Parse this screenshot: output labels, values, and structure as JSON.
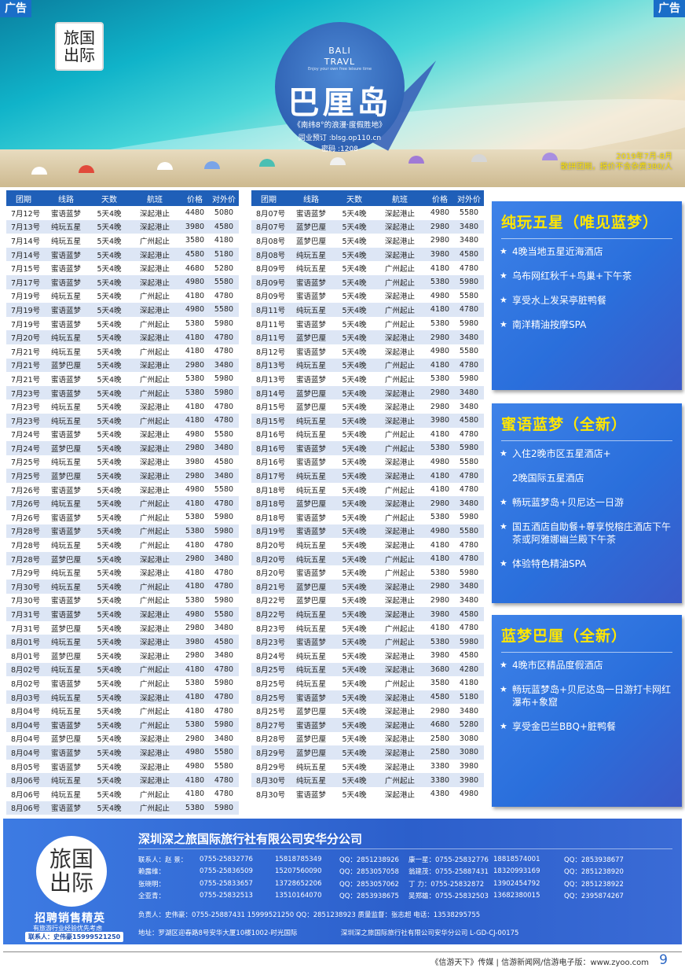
{
  "ads": {
    "left": "广告",
    "right": "广告"
  },
  "banner": {
    "logo_top": "旅国",
    "logo_bottom": "出际",
    "circle_line1": "BALI",
    "circle_line2": "TRAVL",
    "circle_small": "Enjoy your own free leisure time",
    "title": "巴厘岛",
    "subtitle": "《南纬8°的浪漫·度假胜地》",
    "peer_booking": "同业预订 :blsg.op110.cn",
    "password": "密码 :1208",
    "date_info": "2019年7月-8月",
    "note": "散拼团期，报价不含杂费380/人"
  },
  "table_headers": [
    "团期",
    "线路",
    "天数",
    "航班",
    "价格",
    "对外价"
  ],
  "table_left": [
    [
      "7月12号",
      "蜜语蓝梦",
      "5天4晚",
      "深起港止",
      "4480",
      "5080"
    ],
    [
      "7月13号",
      "纯玩五星",
      "5天4晚",
      "深起港止",
      "3980",
      "4580"
    ],
    [
      "7月14号",
      "纯玩五星",
      "5天4晚",
      "广州起止",
      "3580",
      "4180"
    ],
    [
      "7月14号",
      "蜜语蓝梦",
      "5天4晚",
      "深起港止",
      "4580",
      "5180"
    ],
    [
      "7月15号",
      "蜜语蓝梦",
      "5天4晚",
      "深起港止",
      "4680",
      "5280"
    ],
    [
      "7月17号",
      "蜜语蓝梦",
      "5天4晚",
      "深起港止",
      "4980",
      "5580"
    ],
    [
      "7月19号",
      "纯玩五星",
      "5天4晚",
      "广州起止",
      "4180",
      "4780"
    ],
    [
      "7月19号",
      "蜜语蓝梦",
      "5天4晚",
      "深起港止",
      "4980",
      "5580"
    ],
    [
      "7月19号",
      "蜜语蓝梦",
      "5天4晚",
      "广州起止",
      "5380",
      "5980"
    ],
    [
      "7月20号",
      "纯玩五星",
      "5天4晚",
      "深起港止",
      "4180",
      "4780"
    ],
    [
      "7月21号",
      "纯玩五星",
      "5天4晚",
      "广州起止",
      "4180",
      "4780"
    ],
    [
      "7月21号",
      "蓝梦巴厘",
      "5天4晚",
      "深起港止",
      "2980",
      "3480"
    ],
    [
      "7月21号",
      "蜜语蓝梦",
      "5天4晚",
      "广州起止",
      "5380",
      "5980"
    ],
    [
      "7月23号",
      "蜜语蓝梦",
      "5天4晚",
      "广州起止",
      "5380",
      "5980"
    ],
    [
      "7月23号",
      "纯玩五星",
      "5天4晚",
      "深起港止",
      "4180",
      "4780"
    ],
    [
      "7月23号",
      "纯玩五星",
      "5天4晚",
      "广州起止",
      "4180",
      "4780"
    ],
    [
      "7月24号",
      "蜜语蓝梦",
      "5天4晚",
      "深起港止",
      "4980",
      "5580"
    ],
    [
      "7月24号",
      "蓝梦巴厘",
      "5天4晚",
      "深起港止",
      "2980",
      "3480"
    ],
    [
      "7月25号",
      "纯玩五星",
      "5天4晚",
      "深起港止",
      "3980",
      "4580"
    ],
    [
      "7月25号",
      "蓝梦巴厘",
      "5天4晚",
      "深起港止",
      "2980",
      "3480"
    ],
    [
      "7月26号",
      "蜜语蓝梦",
      "5天4晚",
      "深起港止",
      "4980",
      "5580"
    ],
    [
      "7月26号",
      "纯玩五星",
      "5天4晚",
      "广州起止",
      "4180",
      "4780"
    ],
    [
      "7月26号",
      "蜜语蓝梦",
      "5天4晚",
      "广州起止",
      "5380",
      "5980"
    ],
    [
      "7月28号",
      "蜜语蓝梦",
      "5天4晚",
      "广州起止",
      "5380",
      "5980"
    ],
    [
      "7月28号",
      "纯玩五星",
      "5天4晚",
      "广州起止",
      "4180",
      "4780"
    ],
    [
      "7月28号",
      "蓝梦巴厘",
      "5天4晚",
      "深起港止",
      "2980",
      "3480"
    ],
    [
      "7月29号",
      "纯玩五星",
      "5天4晚",
      "深起港止",
      "4180",
      "4780"
    ],
    [
      "7月30号",
      "纯玩五星",
      "5天4晚",
      "广州起止",
      "4180",
      "4780"
    ],
    [
      "7月30号",
      "蜜语蓝梦",
      "5天4晚",
      "广州起止",
      "5380",
      "5980"
    ],
    [
      "7月31号",
      "蜜语蓝梦",
      "5天4晚",
      "深起港止",
      "4980",
      "5580"
    ],
    [
      "7月31号",
      "蓝梦巴厘",
      "5天4晚",
      "深起港止",
      "2980",
      "3480"
    ],
    [
      "8月01号",
      "纯玩五星",
      "5天4晚",
      "深起港止",
      "3980",
      "4580"
    ],
    [
      "8月01号",
      "蓝梦巴厘",
      "5天4晚",
      "深起港止",
      "2980",
      "3480"
    ],
    [
      "8月02号",
      "纯玩五星",
      "5天4晚",
      "广州起止",
      "4180",
      "4780"
    ],
    [
      "8月02号",
      "蜜语蓝梦",
      "5天4晚",
      "广州起止",
      "5380",
      "5980"
    ],
    [
      "8月03号",
      "纯玩五星",
      "5天4晚",
      "深起港止",
      "4180",
      "4780"
    ],
    [
      "8月04号",
      "纯玩五星",
      "5天4晚",
      "广州起止",
      "4180",
      "4780"
    ],
    [
      "8月04号",
      "蜜语蓝梦",
      "5天4晚",
      "广州起止",
      "5380",
      "5980"
    ],
    [
      "8月04号",
      "蓝梦巴厘",
      "5天4晚",
      "深起港止",
      "2980",
      "3480"
    ],
    [
      "8月04号",
      "蜜语蓝梦",
      "5天4晚",
      "深起港止",
      "4980",
      "5580"
    ],
    [
      "8月05号",
      "蜜语蓝梦",
      "5天4晚",
      "深起港止",
      "4980",
      "5580"
    ],
    [
      "8月06号",
      "纯玩五星",
      "5天4晚",
      "深起港止",
      "4180",
      "4780"
    ],
    [
      "8月06号",
      "纯玩五星",
      "5天4晚",
      "广州起止",
      "4180",
      "4780"
    ],
    [
      "8月06号",
      "蜜语蓝梦",
      "5天4晚",
      "广州起止",
      "5380",
      "5980"
    ]
  ],
  "table_right": [
    [
      "8月07号",
      "蜜语蓝梦",
      "5天4晚",
      "深起港止",
      "4980",
      "5580"
    ],
    [
      "8月07号",
      "蓝梦巴厘",
      "5天4晚",
      "深起港止",
      "2980",
      "3480"
    ],
    [
      "8月08号",
      "蓝梦巴厘",
      "5天4晚",
      "深起港止",
      "2980",
      "3480"
    ],
    [
      "8月08号",
      "纯玩五星",
      "5天4晚",
      "深起港止",
      "3980",
      "4580"
    ],
    [
      "8月09号",
      "纯玩五星",
      "5天4晚",
      "广州起止",
      "4180",
      "4780"
    ],
    [
      "8月09号",
      "蜜语蓝梦",
      "5天4晚",
      "广州起止",
      "5380",
      "5980"
    ],
    [
      "8月09号",
      "蜜语蓝梦",
      "5天4晚",
      "深起港止",
      "4980",
      "5580"
    ],
    [
      "8月11号",
      "纯玩五星",
      "5天4晚",
      "广州起止",
      "4180",
      "4780"
    ],
    [
      "8月11号",
      "蜜语蓝梦",
      "5天4晚",
      "广州起止",
      "5380",
      "5980"
    ],
    [
      "8月11号",
      "蓝梦巴厘",
      "5天4晚",
      "深起港止",
      "2980",
      "3480"
    ],
    [
      "8月12号",
      "蜜语蓝梦",
      "5天4晚",
      "深起港止",
      "4980",
      "5580"
    ],
    [
      "8月13号",
      "纯玩五星",
      "5天4晚",
      "广州起止",
      "4180",
      "4780"
    ],
    [
      "8月13号",
      "蜜语蓝梦",
      "5天4晚",
      "广州起止",
      "5380",
      "5980"
    ],
    [
      "8月14号",
      "蓝梦巴厘",
      "5天4晚",
      "深起港止",
      "2980",
      "3480"
    ],
    [
      "8月15号",
      "蓝梦巴厘",
      "5天4晚",
      "深起港止",
      "2980",
      "3480"
    ],
    [
      "8月15号",
      "纯玩五星",
      "5天4晚",
      "深起港止",
      "3980",
      "4580"
    ],
    [
      "8月16号",
      "纯玩五星",
      "5天4晚",
      "广州起止",
      "4180",
      "4780"
    ],
    [
      "8月16号",
      "蜜语蓝梦",
      "5天4晚",
      "广州起止",
      "5380",
      "5980"
    ],
    [
      "8月16号",
      "蜜语蓝梦",
      "5天4晚",
      "深起港止",
      "4980",
      "5580"
    ],
    [
      "8月17号",
      "纯玩五星",
      "5天4晚",
      "深起港止",
      "4180",
      "4780"
    ],
    [
      "8月18号",
      "纯玩五星",
      "5天4晚",
      "广州起止",
      "4180",
      "4780"
    ],
    [
      "8月18号",
      "蓝梦巴厘",
      "5天4晚",
      "深起港止",
      "2980",
      "3480"
    ],
    [
      "8月18号",
      "蜜语蓝梦",
      "5天4晚",
      "广州起止",
      "5380",
      "5980"
    ],
    [
      "8月19号",
      "蜜语蓝梦",
      "5天4晚",
      "深起港止",
      "4980",
      "5580"
    ],
    [
      "8月20号",
      "纯玩五星",
      "5天4晚",
      "深起港止",
      "4180",
      "4780"
    ],
    [
      "8月20号",
      "纯玩五星",
      "5天4晚",
      "广州起止",
      "4180",
      "4780"
    ],
    [
      "8月20号",
      "蜜语蓝梦",
      "5天4晚",
      "广州起止",
      "5380",
      "5980"
    ],
    [
      "8月21号",
      "蓝梦巴厘",
      "5天4晚",
      "深起港止",
      "2980",
      "3480"
    ],
    [
      "8月22号",
      "蓝梦巴厘",
      "5天4晚",
      "深起港止",
      "2980",
      "3480"
    ],
    [
      "8月22号",
      "纯玩五星",
      "5天4晚",
      "深起港止",
      "3980",
      "4580"
    ],
    [
      "8月23号",
      "纯玩五星",
      "5天4晚",
      "广州起止",
      "4180",
      "4780"
    ],
    [
      "8月23号",
      "蜜语蓝梦",
      "5天4晚",
      "广州起止",
      "5380",
      "5980"
    ],
    [
      "8月24号",
      "纯玩五星",
      "5天4晚",
      "深起港止",
      "3980",
      "4580"
    ],
    [
      "8月25号",
      "纯玩五星",
      "5天4晚",
      "深起港止",
      "3680",
      "4280"
    ],
    [
      "8月25号",
      "纯玩五星",
      "5天4晚",
      "广州起止",
      "3580",
      "4180"
    ],
    [
      "8月25号",
      "蜜语蓝梦",
      "5天4晚",
      "深起港止",
      "4580",
      "5180"
    ],
    [
      "8月25号",
      "蓝梦巴厘",
      "5天4晚",
      "深起港止",
      "2980",
      "3480"
    ],
    [
      "8月27号",
      "蜜语蓝梦",
      "5天4晚",
      "深起港止",
      "4680",
      "5280"
    ],
    [
      "8月28号",
      "蓝梦巴厘",
      "5天4晚",
      "深起港止",
      "2580",
      "3080"
    ],
    [
      "8月29号",
      "蓝梦巴厘",
      "5天4晚",
      "深起港止",
      "2580",
      "3080"
    ],
    [
      "8月29号",
      "纯玩五星",
      "5天4晚",
      "深起港止",
      "3380",
      "3980"
    ],
    [
      "8月30号",
      "纯玩五星",
      "5天4晚",
      "广州起止",
      "3380",
      "3980"
    ],
    [
      "8月30号",
      "蜜语蓝梦",
      "5天4晚",
      "深起港止",
      "4380",
      "4980"
    ]
  ],
  "panels": [
    {
      "title": "纯玩五星（唯见蓝梦）",
      "items": [
        "4晚当地五星近海酒店",
        "乌布网红秋千+鸟巢+下午茶",
        "享受水上发呆亭脏鸭餐",
        "南洋精油按摩SPA"
      ]
    },
    {
      "title": "蜜语蓝梦（全新）",
      "items": [
        "入住2晚市区五星酒店+",
        "2晚国际五星酒店",
        "畅玩蓝梦岛+贝尼达一日游",
        "国五酒店自助餐+尊享悦榕庄酒店下午茶或阿雅娜幽兰殿下午茶",
        "体验特色精油SPA"
      ]
    },
    {
      "title": "蓝梦巴厘（全新）",
      "items": [
        "4晚市区精品度假酒店",
        "畅玩蓝梦岛+贝尼达岛一日游打卡网红瀑布+象窟",
        "享受金巴兰BBQ+脏鸭餐"
      ]
    }
  ],
  "footer": {
    "logo_top": "旅国",
    "logo_bottom": "出际",
    "recruit": "招聘销售精英",
    "recruit_sub": "有旅游行业经验优先考虑",
    "recruit_contact": "联系人：史伟豪15999521250",
    "company": "深圳深之旅国际旅行社有限公司安华分公司",
    "contacts": [
      [
        "联系人：赵    景：",
        "0755-25832776",
        "15818785349",
        "QQ：2851238926",
        "康一星：0755-25832776",
        "18818574001",
        "QQ：2853938677"
      ],
      [
        "赖露维：",
        "0755-25836509",
        "15207560090",
        "QQ：2853057058",
        "翁建茂：0755-25887431",
        "18320993169",
        "QQ：2851238920"
      ],
      [
        "张晓明：",
        "0755-25833657",
        "13728652206",
        "QQ：2853057062",
        "丁    力：0755-25832872",
        "13902454792",
        "QQ：2851238922"
      ],
      [
        "全亚青：",
        "0755-25832513",
        "13510164070",
        "QQ：2853938675",
        "吴郑雄：0755-25832503",
        "13682380015",
        "QQ：2395874267"
      ]
    ],
    "responsible": "负责人：史伟豪：0755-25887431      15999521250      QQ：2851238923      质量监督：张志超  电话：13538295755",
    "address": "地址：罗湖区迎春路8号安华大厦10楼1002-时光国际",
    "license": "深圳深之旅国际旅行社有限公司安华分公司 L-GD-CJ-00175",
    "bottom_line": "《信游天下》传媒 | 信游新闻网/信游电子版：www.zyoo.com",
    "page": "9"
  }
}
